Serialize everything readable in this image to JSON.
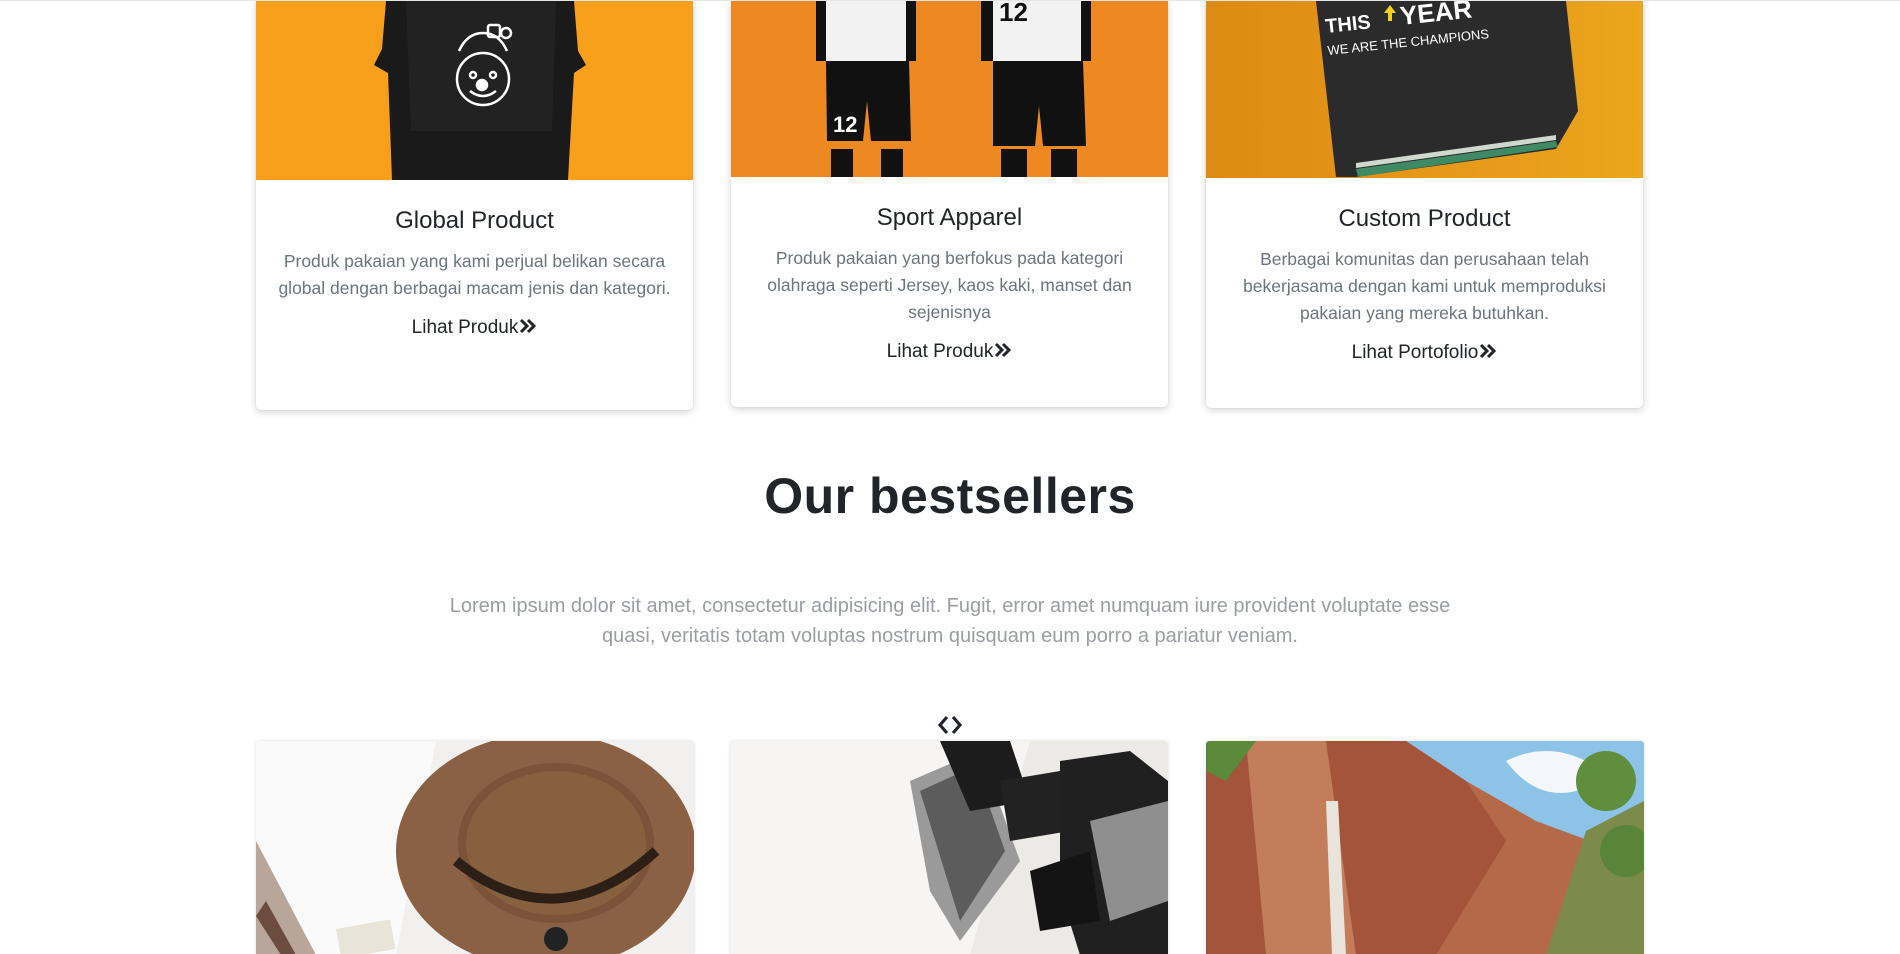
{
  "categories": [
    {
      "title": "Global Product",
      "text": "Produk pakaian yang kami perjual belikan secara global dengan berbagai macam jenis dan kategori.",
      "link_label": "Lihat Produk",
      "image_icon": "black-tshirt-photo"
    },
    {
      "title": "Sport Apparel",
      "text": "Produk pakaian yang berfokus pada kategori olahraga seperti Jersey, kaos kaki, manset dan sejenisnya",
      "link_label": "Lihat Produk",
      "image_icon": "football-kit-photo",
      "jersey_numbers": [
        "12",
        "12"
      ]
    },
    {
      "title": "Custom Product",
      "text": "Berbagai komunitas dan perusahaan telah bekerjasama dengan kami untuk memproduksi pakaian yang mereka butuhkan.",
      "link_label": "Lihat Portofolio",
      "image_icon": "folded-custom-shirt-photo",
      "shirt_print": {
        "line1": "THIS",
        "line1_b": "YEAR",
        "line2": "WE ARE THE CHAMPIONS"
      }
    }
  ],
  "bestsellers": {
    "title": "Our bestsellers",
    "lead": "Lorem ipsum dolor sit amet, consectetur adipisicing elit. Fugit, error amet numquam iure provident voluptate esse quasi, veritatis totam voluptas nostrum quisquam eum porro a pariatur veniam.",
    "carousel_icon": "chevrons-left-right-icon",
    "items": [
      {
        "image_icon": "brown-hat-photo"
      },
      {
        "image_icon": "black-sandals-photo"
      },
      {
        "image_icon": "canyon-waterfall-photo"
      }
    ]
  },
  "colors": {
    "orange_1": "#f7a11e",
    "orange_2": "#ee8a22",
    "orange_3": "#e99a1e",
    "text_muted": "#6c757d",
    "heading": "#212529"
  }
}
